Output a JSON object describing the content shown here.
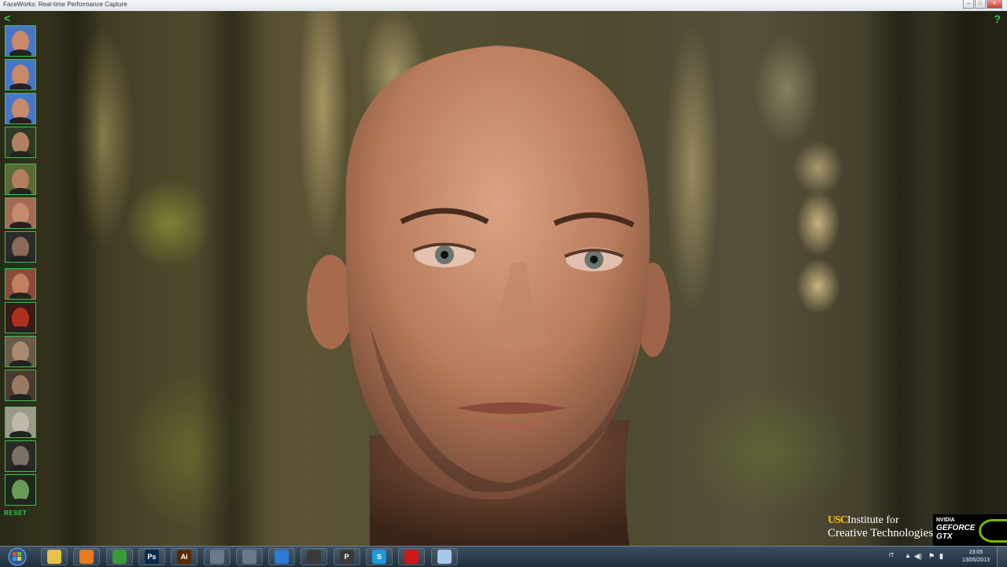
{
  "window": {
    "title": "FaceWorks: Real-time Performance Capture",
    "minimize_label": "–",
    "maximize_label": "□",
    "close_label": "x"
  },
  "app": {
    "back_label": "<",
    "help_label": "?",
    "reset_label": "RESET",
    "thumbnails": [
      {
        "name": "thumb-face-neutral",
        "bg": "#4a76c8",
        "skin": "#c98a6a"
      },
      {
        "name": "thumb-face-talk",
        "bg": "#4a76c8",
        "skin": "#c98a6a"
      },
      {
        "name": "thumb-face-shout",
        "bg": "#4a76c8",
        "skin": "#c98a6a"
      },
      {
        "name": "thumb-face-compare",
        "bg": "#2f3a24",
        "skin": "#b08060"
      },
      {
        "name": "thumb-forest-head",
        "bg": "#5a6a34",
        "skin": "#b47e62"
      },
      {
        "name": "thumb-light-head",
        "bg": "#a36a54",
        "skin": "#c48a70"
      },
      {
        "name": "thumb-dark-head",
        "bg": "#2a2a2a",
        "skin": "#8a6a58"
      },
      {
        "name": "thumb-warm-head",
        "bg": "#8a4a3a",
        "skin": "#c08060"
      },
      {
        "name": "thumb-ear-closeup",
        "bg": "#3a1a18",
        "skin": "#b03020"
      },
      {
        "name": "thumb-eye-closeup",
        "bg": "#6a5a48",
        "skin": "#a88a70"
      },
      {
        "name": "thumb-eyes-pair",
        "bg": "#4a3a30",
        "skin": "#9a7a62"
      },
      {
        "name": "thumb-wireframe-head",
        "bg": "#9a9a8a",
        "skin": "#c0b8a8"
      },
      {
        "name": "thumb-grey-render",
        "bg": "#2a2a24",
        "skin": "#7a7264"
      },
      {
        "name": "thumb-normal-map",
        "bg": "#1a2a1a",
        "skin": "#6a9a5a"
      }
    ]
  },
  "logos": {
    "usc_mark": "USC",
    "usc_line1": "Institute for",
    "usc_line2": "Creative Technologies",
    "nvidia_line1": "NVIDIA",
    "nvidia_line2": "GEFORCE",
    "nvidia_line3": "GTX"
  },
  "taskbar": {
    "apps": [
      {
        "name": "explorer-icon",
        "label": "",
        "color": "#e8c24a"
      },
      {
        "name": "media-player-icon",
        "label": "",
        "color": "#e87a20"
      },
      {
        "name": "chrome-icon",
        "label": "",
        "color": "#3a9a3a"
      },
      {
        "name": "photoshop-icon",
        "label": "Ps",
        "color": "#0a2a4a"
      },
      {
        "name": "illustrator-icon",
        "label": "Ai",
        "color": "#5a2a00"
      },
      {
        "name": "tool-icon",
        "label": "",
        "color": "#6a7a8a"
      },
      {
        "name": "utility-icon",
        "label": "",
        "color": "#6a7a8a"
      },
      {
        "name": "circle-app-icon",
        "label": "",
        "color": "#2a7ad8"
      },
      {
        "name": "x-app-icon",
        "label": "",
        "color": "#3a3a3a"
      },
      {
        "name": "p-app-icon",
        "label": "P",
        "color": "#3a3a3a"
      },
      {
        "name": "skype-icon",
        "label": "S",
        "color": "#1a9ae0"
      },
      {
        "name": "red-app-icon",
        "label": "",
        "color": "#d01818"
      },
      {
        "name": "window-app-icon",
        "label": "",
        "color": "#a8c8e8"
      }
    ],
    "language": "IT",
    "time": "23:05",
    "date": "13/05/2013"
  },
  "colors": {
    "accent_green": "#2fd04a",
    "usc_gold": "#f2c200",
    "nvidia_green": "#76b900"
  }
}
